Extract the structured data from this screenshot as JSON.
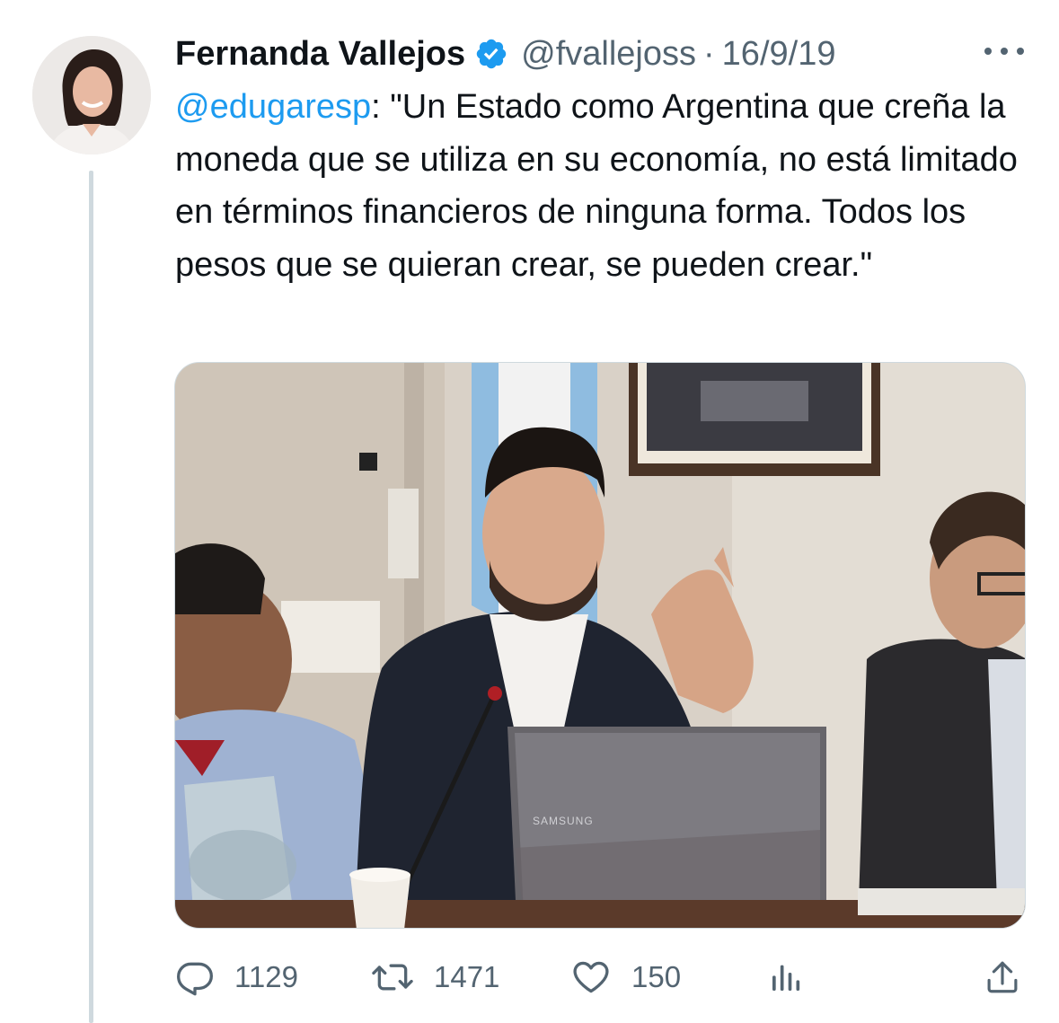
{
  "author": {
    "display_name": "Fernanda Vallejos",
    "handle": "@fvallejoss",
    "separator": "·",
    "date": "16/9/19",
    "verified": true,
    "avatar_icon": "profile-photo"
  },
  "tweet": {
    "mention": "@edugaresp",
    "text": ": \"Un Estado como Argentina que creña la moneda que se utiliza en su economía, no está limitado en términos financieros de ninguna forma. Todos los pesos que se quieran crear, se pueden crear.\""
  },
  "media": {
    "laptop_brand": "SAMSUNG"
  },
  "actions": {
    "reply_count": "1129",
    "retweet_count": "1471",
    "like_count": "150"
  },
  "colors": {
    "accent": "#1d9bf0",
    "secondary_text": "#536471",
    "thread_line": "#cfd9de"
  }
}
